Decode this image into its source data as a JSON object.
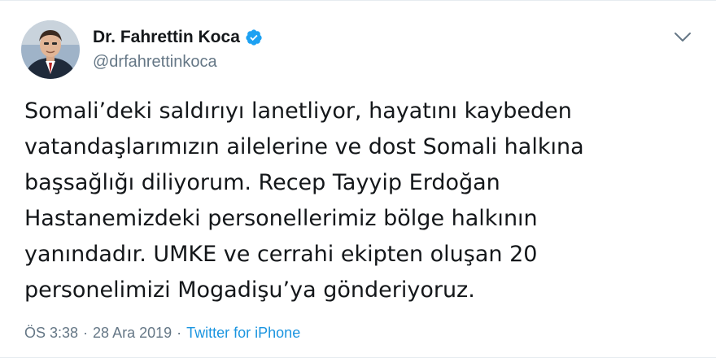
{
  "author": {
    "display_name": "Dr. Fahrettin Koca",
    "handle": "@drfahrettinkoca",
    "verified": true
  },
  "tweet": {
    "lines": [
      "Somali’deki saldırıyı lanetliyor, hayatını kaybeden",
      "vatandaşlarımızın ailelerine ve dost Somali halkına",
      "başsağlığı diliyorum. Recep Tayyip Erdoğan",
      "Hastanemizdeki personellerimiz bölge halkının",
      "yanındadır. UMKE ve cerrahi ekipten oluşan 20",
      "personelimizi Mogadişu’ya gönderiyoruz."
    ]
  },
  "meta": {
    "time": "ÖS 3:38",
    "separator": "·",
    "date": "28 Ara 2019",
    "source": "Twitter for iPhone"
  },
  "icons": {
    "verified": "verified-badge-icon",
    "menu": "chevron-down-icon"
  },
  "colors": {
    "text": "#14171a",
    "secondary": "#657786",
    "link": "#1b95e0",
    "verified": "#1da1f2"
  }
}
